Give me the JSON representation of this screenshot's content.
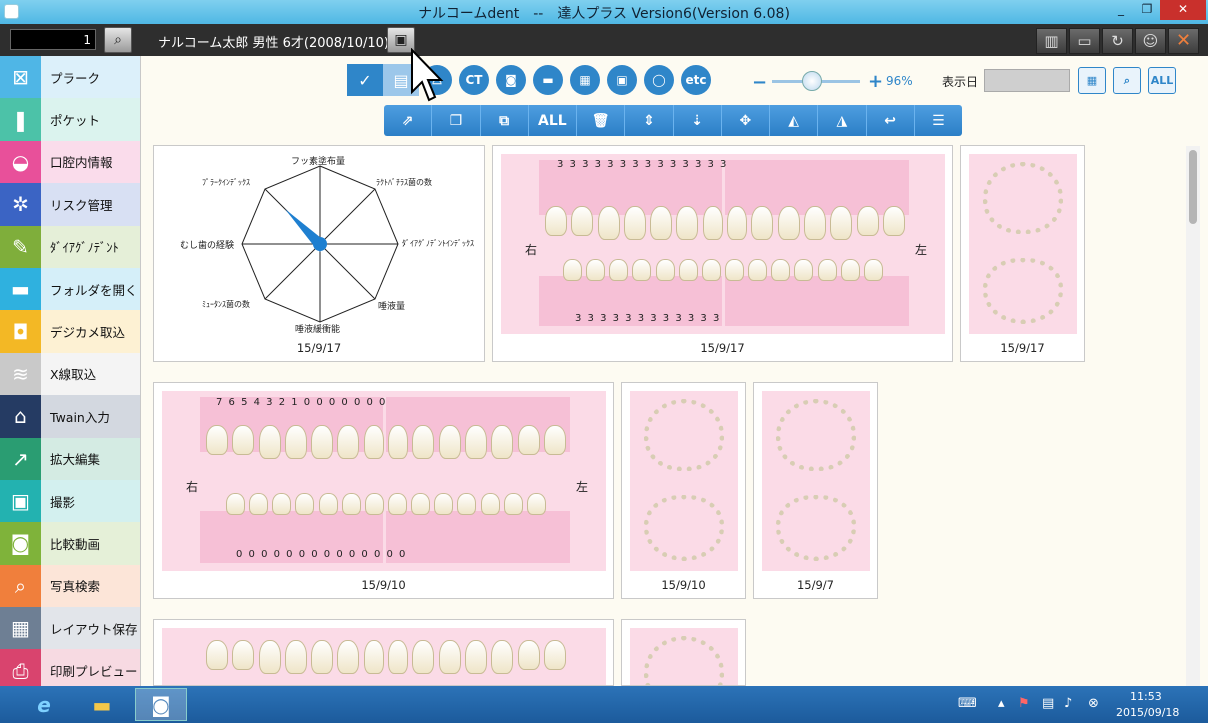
{
  "window": {
    "title": "ナルコームdent　--　達人プラス Version6(Version 6.08)",
    "minimize": "_",
    "restore": "❐",
    "close": "✕"
  },
  "header": {
    "patient_id": "1",
    "patient_info": "ナルコーム太郎 男性 6才(2008/10/10)",
    "search_icon": "magnifier-icon",
    "person_icon": "person-card-icon"
  },
  "sidebar": {
    "items": [
      {
        "label": "プラーク",
        "color": "#4fb6e6",
        "icon": "⊠"
      },
      {
        "label": "ポケット",
        "color": "#4cc2a8",
        "icon": "❚"
      },
      {
        "label": "口腔内情報",
        "color": "#e8509a",
        "icon": "◒"
      },
      {
        "label": "リスク管理",
        "color": "#3b64c4",
        "icon": "✲"
      },
      {
        "label": "ﾀﾞｲｱｸﾞﾉﾃﾞﾝﾄ",
        "color": "#7fae3b",
        "icon": "✎"
      },
      {
        "label": "フォルダを開く",
        "color": "#2fb1df",
        "icon": "▬"
      },
      {
        "label": "デジカメ取込",
        "color": "#f3b825",
        "icon": "◘"
      },
      {
        "label": "X線取込",
        "color": "#c9c9c9",
        "icon": "≋"
      },
      {
        "label": "Twain入力",
        "color": "#253b63",
        "icon": "⌂"
      },
      {
        "label": "拡大編集",
        "color": "#2a9d72",
        "icon": "↗"
      },
      {
        "label": "撮影",
        "color": "#23b2b0",
        "icon": "▣"
      },
      {
        "label": "比較動画",
        "color": "#7fb33a",
        "icon": "◙"
      },
      {
        "label": "写真検索",
        "color": "#f07f3c",
        "icon": "⌕"
      },
      {
        "label": "レイアウト保存",
        "color": "#6e7f94",
        "icon": "▦"
      },
      {
        "label": "印刷プレビュー",
        "color": "#d9446e",
        "icon": "⎙"
      }
    ]
  },
  "toolbar": {
    "view_buttons": [
      "✓",
      "▤",
      "⌓",
      "CT",
      "◙",
      "▬",
      "▦",
      "▣",
      "◯",
      "etc"
    ],
    "zoom": {
      "minus": "−",
      "plus": "+",
      "value": "96%"
    },
    "date_label": "表示日",
    "right_buttons": [
      "▦",
      "⌕",
      "ALL"
    ],
    "edit_buttons": [
      "⇗",
      "❐",
      "⧉",
      "ALL",
      "🗑",
      "⇕",
      "⇣",
      "✥",
      "◭",
      "◮",
      "↩",
      "☰"
    ]
  },
  "cards": {
    "radar": {
      "labels": {
        "top": "フッ素塗布量",
        "top_right": "ﾗｸﾄﾊﾞﾁﾗｽ菌の数",
        "right": "ﾀﾞｲｱｸﾞﾉﾃﾞﾝﾄｲﾝﾃﾞｯｸｽ",
        "bottom_right": "唾液量",
        "bottom": "唾液緩衝能",
        "bottom_left": "ﾐｭｰﾀﾝｽ菌の数",
        "left": "むし歯の経験",
        "top_left": "ﾌﾟﾗｰｸｲﾝﾃﾞｯｸｽ"
      },
      "date": "15/9/17"
    },
    "perio1": {
      "upper_numbers": "3   3   3   3   3   3   3   3   3   3   3   3   3   3",
      "lower_numbers": "3   3   3   3   3   3   3   3   3   3   3   3",
      "right": "右",
      "left": "左",
      "date": "15/9/17"
    },
    "occl1": {
      "date": "15/9/17"
    },
    "perio2": {
      "upper_numbers": "7   6   5   4   3   2   1     0   0   0   0   0   0   0",
      "lower_numbers": "0   0   0   0   0   0   0     0   0   0   0   0   0   0",
      "right": "右",
      "left": "左",
      "date": "15/9/10"
    },
    "occl2": {
      "date": "15/9/10"
    },
    "occl3": {
      "date": "15/9/7"
    }
  },
  "taskbar": {
    "clock_time": "11:53",
    "clock_date": "2015/09/18"
  }
}
